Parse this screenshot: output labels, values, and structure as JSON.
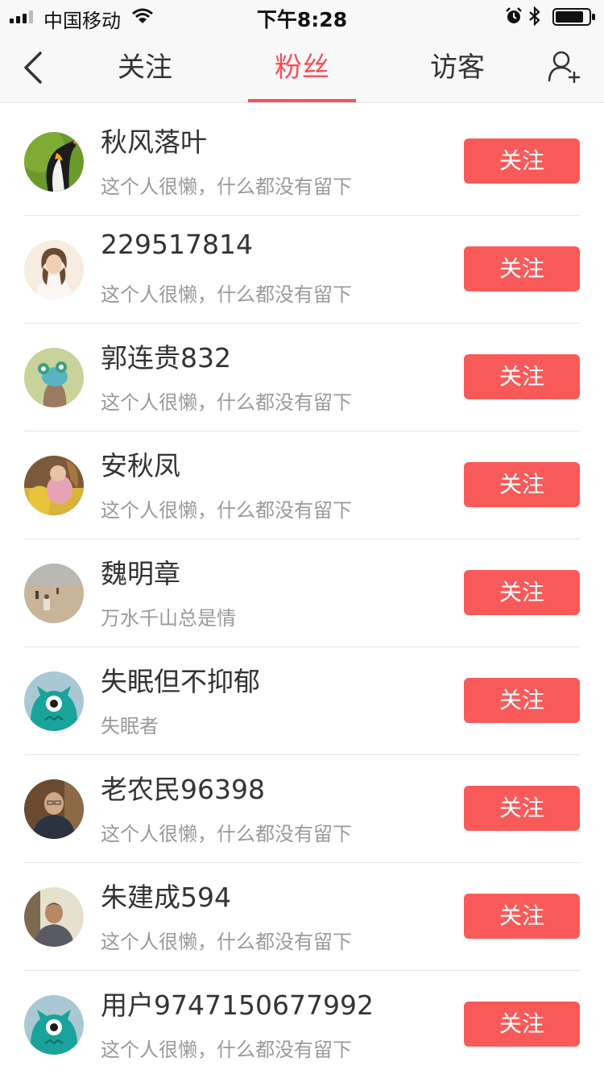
{
  "status_bar": {
    "carrier": "中国移动",
    "time": "下午8:28",
    "icons": [
      "signal-icon",
      "wifi-icon",
      "alarm-icon",
      "bluetooth-icon",
      "battery-icon"
    ]
  },
  "header": {
    "tabs": [
      {
        "label": "关注",
        "active": false
      },
      {
        "label": "粉丝",
        "active": true
      },
      {
        "label": "访客",
        "active": false
      }
    ],
    "icons": {
      "back": "chevron-left-icon",
      "add_user": "add-user-icon"
    },
    "accent_color": "#f2525b"
  },
  "fans": [
    {
      "name": "秋风落叶",
      "bio": "这个人很懒，什么都没有留下",
      "button": "关注",
      "avatar": "penguin"
    },
    {
      "name": "229517814",
      "bio": "这个人很懒，什么都没有留下",
      "button": "关注",
      "avatar": "woman-photo"
    },
    {
      "name": "郭连贵832",
      "bio": "这个人很懒，什么都没有留下",
      "button": "关注",
      "avatar": "green-cartoon"
    },
    {
      "name": "安秋凤",
      "bio": "这个人很懒，什么都没有留下",
      "button": "关注",
      "avatar": "child-photo"
    },
    {
      "name": "魏明章",
      "bio": "万水千山总是情",
      "button": "关注",
      "avatar": "beach-photo"
    },
    {
      "name": "失眠但不抑郁",
      "bio": "失眠者",
      "button": "关注",
      "avatar": "teal-monster-default"
    },
    {
      "name": "老农民96398",
      "bio": "这个人很懒，什么都没有留下",
      "button": "关注",
      "avatar": "elderly-man-photo"
    },
    {
      "name": "朱建成594",
      "bio": "这个人很懒，什么都没有留下",
      "button": "关注",
      "avatar": "man-photo"
    },
    {
      "name": "用户9747150677992",
      "bio": "这个人很懒，什么都没有留下",
      "button": "关注",
      "avatar": "teal-monster-default"
    }
  ],
  "colors": {
    "follow_button": "#f85a5a",
    "bio_text": "#9a9a9a"
  }
}
